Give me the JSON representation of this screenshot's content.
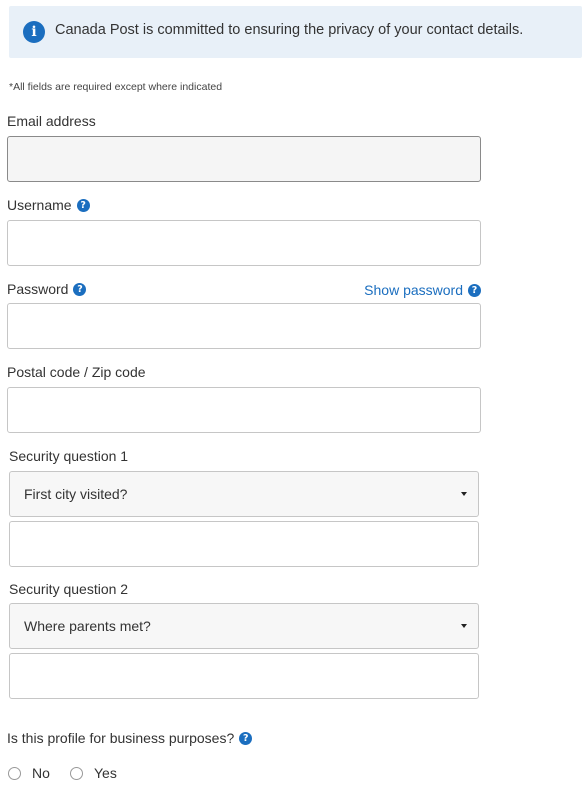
{
  "banner": {
    "icon": "info-icon",
    "text": "Canada Post is committed to ensuring the privacy of your contact details."
  },
  "required_note": "*All fields are required except where indicated",
  "fields": {
    "email": {
      "label": "Email address",
      "value": ""
    },
    "username": {
      "label": "Username",
      "value": ""
    },
    "password": {
      "label": "Password",
      "value": "",
      "show_password_label": "Show password"
    },
    "postal": {
      "label": "Postal code / Zip code",
      "value": ""
    }
  },
  "security": {
    "q1": {
      "label": "Security question 1",
      "selected": "First city visited?",
      "answer": ""
    },
    "q2": {
      "label": "Security question 2",
      "selected": "Where parents met?",
      "answer": ""
    }
  },
  "business": {
    "question": "Is this profile for business purposes?",
    "options": [
      "No",
      "Yes"
    ]
  },
  "colors": {
    "accent": "#1b6ebf",
    "banner_bg": "#e8f0f8"
  }
}
